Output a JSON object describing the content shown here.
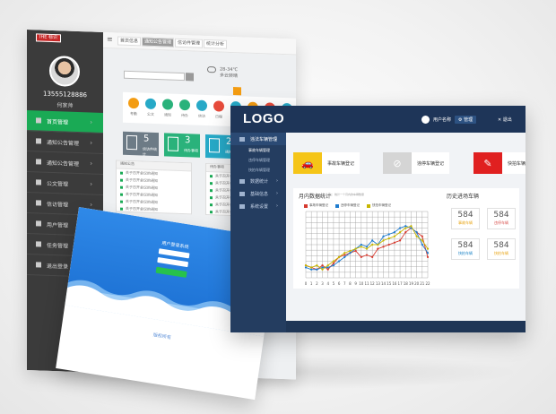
{
  "back_panel": {
    "logo_text": "IHE 标识",
    "phone": "13555128886",
    "username": "何家帅",
    "menu": [
      {
        "label": "首页管理",
        "active": true
      },
      {
        "label": "通知公告管理",
        "active": false
      },
      {
        "label": "通知公告管理",
        "active": false
      },
      {
        "label": "公文管理",
        "active": false
      },
      {
        "label": "信访管理",
        "active": false
      },
      {
        "label": "用户管理",
        "active": false
      },
      {
        "label": "任务管理",
        "active": false
      },
      {
        "label": "退出登录",
        "active": false
      }
    ],
    "tabs": [
      {
        "label": "首页信息",
        "active": false
      },
      {
        "label": "通知公告管理",
        "active": true
      },
      {
        "label": "信访件管理",
        "active": false
      },
      {
        "label": "统计分析",
        "active": false
      }
    ],
    "weather": [
      "28-34℃",
      "多云转晴"
    ],
    "icon_labels": [
      "考勤",
      "公文",
      "通知",
      "待办",
      "信访",
      "日程",
      "统计",
      "消息",
      "邮件",
      "设置"
    ],
    "cards": [
      {
        "number": "5",
        "caption": "信访件统计",
        "color": "#6d7b86"
      },
      {
        "number": "3",
        "caption": "待办事项",
        "color": "#2ab27b"
      },
      {
        "number": "2",
        "caption": "通知公告",
        "color": "#27a9c7"
      }
    ],
    "list_left": {
      "title": "通知公告",
      "items": [
        "关于召开会议的通知",
        "关于召开会议的通知",
        "关于召开会议的通知",
        "关于召开会议的通知",
        "关于召开会议的通知",
        "关于召开会议的通知"
      ]
    },
    "list_right": {
      "title": "待办事项",
      "items": [
        "关于召开会议的通知",
        "关于召开会议的通知",
        "关于召开会议的通知",
        "关于召开会议的通知",
        "关于召开会议的通知",
        "关于召开会议的通知"
      ]
    }
  },
  "login_panel": {
    "title": "用户登录系统",
    "footer": "版权所有"
  },
  "front_panel": {
    "logo": "LOGO",
    "username": "用户名称",
    "manage_btn": "管理",
    "exit_btn": "退出",
    "sidebar": [
      {
        "type": "group",
        "label": "违法车辆管理",
        "active": true
      },
      {
        "type": "sub",
        "label": "事故车辆管理",
        "active": true
      },
      {
        "type": "sub",
        "label": "违停车辆管理",
        "active": false
      },
      {
        "type": "sub",
        "label": "快拍车辆管理",
        "active": false
      },
      {
        "type": "group",
        "label": "数据统计",
        "active": false
      },
      {
        "type": "group",
        "label": "基础信息",
        "active": false
      },
      {
        "type": "group",
        "label": "系统设置",
        "active": false
      }
    ],
    "quick_cards": [
      {
        "label": "事故车辆登记",
        "color": "#f5c518",
        "icon": "car-crash-icon"
      },
      {
        "label": "违停车辆登记",
        "color": "#d5d5d5",
        "icon": "car-icon"
      },
      {
        "label": "快拍车辆登记",
        "color": "#e02020",
        "icon": "camera-edit-icon"
      }
    ],
    "chart_panel": {
      "title": "月内数据统计",
      "subtitle": "注：统计一个月内的车辆数量",
      "history_title": "历史进场车辆"
    },
    "history_stats": [
      {
        "value": "584",
        "caption": "事故车辆",
        "color": "#e8a516"
      },
      {
        "value": "584",
        "caption": "违停车辆",
        "color": "#d9534f"
      },
      {
        "value": "584",
        "caption": "快拍车辆",
        "color": "#1a83c6"
      },
      {
        "value": "584",
        "caption": "快拍车辆",
        "color": "#e8a516"
      }
    ]
  },
  "chart_data": {
    "type": "line",
    "title": "",
    "x": [
      0,
      1,
      2,
      3,
      4,
      5,
      6,
      7,
      8,
      9,
      10,
      11,
      12,
      13,
      14,
      15,
      16,
      17,
      18,
      19,
      20,
      21,
      22
    ],
    "ylim": [
      0,
      16
    ],
    "grid": true,
    "legend": "top-left",
    "series": [
      {
        "name": "事故车辆登记",
        "color": "#d63a2f",
        "values": [
          3,
          2.5,
          2,
          3,
          2,
          3.5,
          5,
          5.5,
          6,
          6.5,
          5,
          5.5,
          5,
          7,
          7.5,
          8,
          8.5,
          9,
          11,
          12,
          11,
          10,
          5
        ]
      },
      {
        "name": "违停车辆登记",
        "color": "#1f7ccf",
        "values": [
          2.5,
          2,
          2,
          2.5,
          2.5,
          3,
          4,
          5,
          6,
          7,
          8,
          7.5,
          9,
          8,
          10,
          10.5,
          11,
          12,
          12.5,
          12,
          11,
          8,
          6
        ]
      },
      {
        "name": "快拍车辆登记",
        "color": "#c7b600",
        "values": [
          3,
          2.5,
          3,
          2,
          3,
          4,
          5,
          6,
          6.5,
          7,
          7.5,
          7,
          8,
          8,
          9,
          9.5,
          10,
          11,
          12,
          12.5,
          10,
          9,
          7
        ]
      }
    ]
  }
}
